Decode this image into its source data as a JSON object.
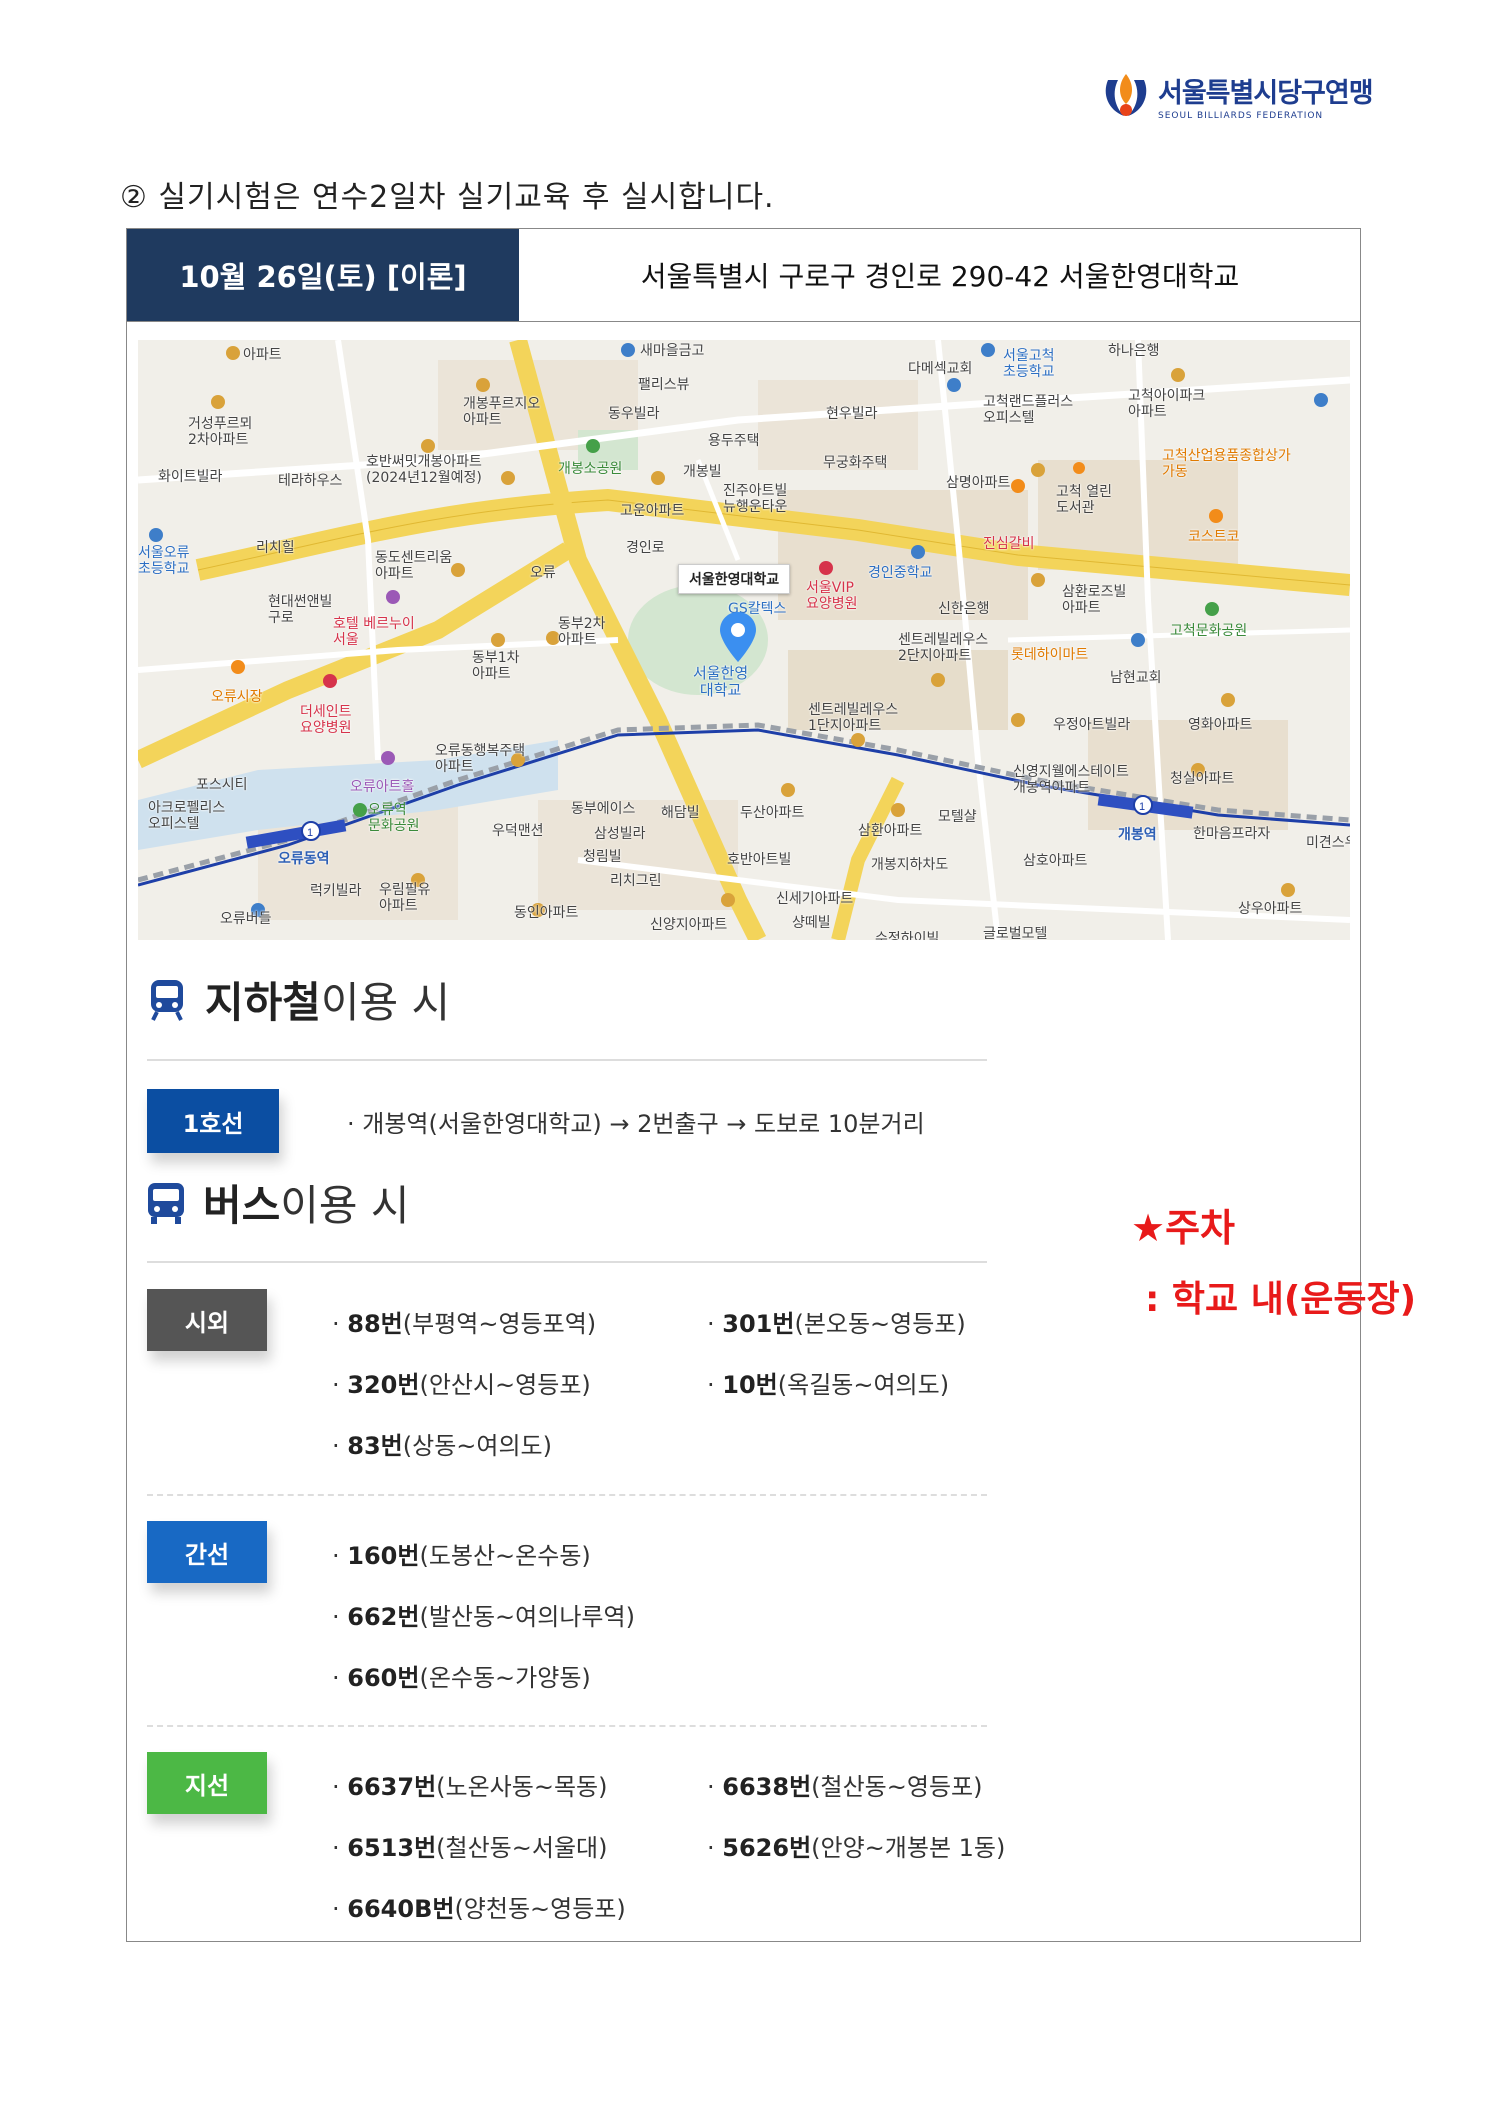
{
  "logo": {
    "name_ko": "서울특별시당구연맹",
    "name_en": "SEOUL BILLIARDS FEDERATION"
  },
  "notice": "② 실기시험은 연수2일차 실기교육 후 실시합니다.",
  "header": {
    "date": "10월 26일(토) [이론]",
    "address": "서울특별시 구로구 경인로 290-42 서울한영대학교"
  },
  "map": {
    "callout": "서울한영대학교",
    "pin_label": "서울한영\n대학교",
    "labels": [
      "아파트",
      "개봉푸르지오\n아파트",
      "동우빌라",
      "팰리스뷰",
      "새마을금고",
      "다메섹교회",
      "서울고척\n초등학교",
      "하나은행",
      "고척아이파크\n아파트",
      "거성푸르뫼\n2차아파트",
      "화이트빌라",
      "테라하우스",
      "호반써밋개봉아파트\n(2024년12월예정)",
      "개봉소공원",
      "용두주택",
      "현우빌라",
      "고척랜드플러스\n오피스텔",
      "고척산업용품종합상가\n가동",
      "개봉빌",
      "무궁화주택",
      "삼명아파트",
      "고척 열린\n도서관",
      "고운아파트",
      "진주아트빌\n뉴행운타운",
      "코스트코",
      "진심갈비",
      "서울오류\n초등학교",
      "리치힐",
      "동도센트리움\n아파트",
      "오류",
      "경인로",
      "경인중학교",
      "서울VIP\n요양병원",
      "삼환로즈빌\n아파트",
      "현대썬앤빌\n구로",
      "호텔 베르누이\n서울",
      "동부2차\n아파트",
      "GS칼텍스",
      "신한은행",
      "고척문화공원",
      "센트레빌레우스\n2단지아파트",
      "롯데하이마트",
      "남현교회",
      "오류시장",
      "더세인트\n요양병원",
      "동부1차\n아파트",
      "센트레빌레우스\n1단지아파트",
      "우정아트빌라",
      "영화아파트",
      "오류동행복주택\n아파트",
      "오류아트홀",
      "포스시티",
      "신영지웰에스테이트\n개봉역아파트",
      "청실아파트",
      "아크로펠리스\n오피스텔",
      "오류역\n문화공원",
      "동부에이스",
      "해담빌",
      "두산아파트",
      "모텔샬",
      "한마음프라자",
      "미견스우",
      "우덕맨션",
      "삼성빌라",
      "삼환아파트",
      "청림빌",
      "호반아트빌",
      "개봉지하차도",
      "삼호아파트",
      "럭키빌라",
      "우림필유\n아파트",
      "리치그린",
      "신세기아파트",
      "오류버들",
      "동인아파트",
      "신양지아파트",
      "샹떼빌",
      "수정하이빌",
      "글로벌모텔",
      "상우아파트",
      "오류동역",
      "개봉역"
    ]
  },
  "parking": {
    "title": "★주차",
    "detail": ": 학교  내(운동장)"
  },
  "subway": {
    "title_bold": "지하철",
    "title_rest": "이용 시",
    "badge": "1호선",
    "text": "· 개봉역(서울한영대학교) → 2번출구 → 도보로 10분거리"
  },
  "bus": {
    "title_bold": "버스",
    "title_rest": "이용 시",
    "groups": [
      {
        "badge": "시외",
        "items": [
          {
            "num": "88번",
            "route": "(부평역~영등포역)"
          },
          {
            "num": "301번",
            "route": "(본오동~영등포)"
          },
          {
            "num": "320번",
            "route": "(안산시~영등포)"
          },
          {
            "num": "10번",
            "route": "(옥길동~여의도)"
          },
          {
            "num": "83번",
            "route": "(상동~여의도)"
          }
        ]
      },
      {
        "badge": "간선",
        "items": [
          {
            "num": "160번",
            "route": "(도봉산~온수동)"
          },
          {
            "num": "662번",
            "route": "(발산동~여의나루역)"
          },
          {
            "num": "660번",
            "route": "(온수동~가양동)"
          }
        ]
      },
      {
        "badge": "지선",
        "items": [
          {
            "num": "6637번",
            "route": "(노온사동~목동)"
          },
          {
            "num": "6638번",
            "route": "(철산동~영등포)"
          },
          {
            "num": "6513번",
            "route": "(철산동~서울대)"
          },
          {
            "num": "5626번",
            "route": "(안양~개봉본 1동)"
          },
          {
            "num": "6640B번",
            "route": "(양천동~영등포)"
          }
        ]
      }
    ]
  },
  "colors": {
    "header": "#1f3a5f",
    "line1": "#0b4ea2",
    "sioe": "#555555",
    "gan": "#1869c4",
    "ji": "#4cb845",
    "parking": "#e81a1a"
  }
}
